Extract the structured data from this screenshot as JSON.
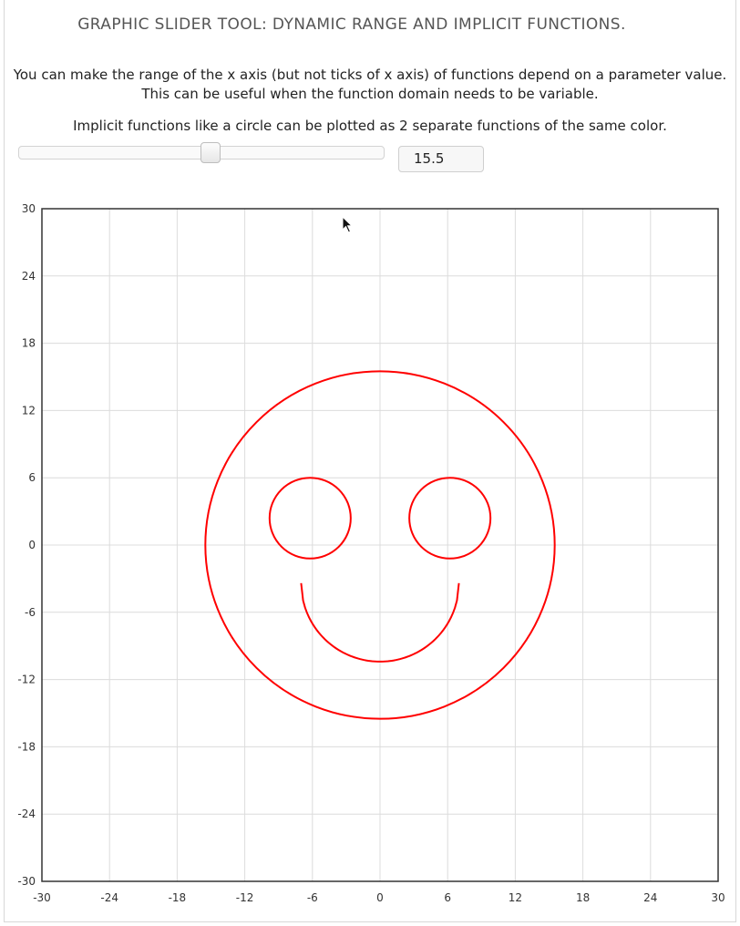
{
  "header": {
    "title": "GRAPHIC SLIDER TOOL: DYNAMIC RANGE AND IMPLICIT FUNCTIONS.",
    "description_line1": "You can make the range of the x axis (but not ticks of x axis) of functions depend on a parameter value.",
    "description_line2": "This can be useful when the function domain needs to be variable.",
    "description_line3": "Implicit functions like a circle can be plotted as 2 separate functions of the same color."
  },
  "slider": {
    "value": "15.5",
    "min": 0,
    "max": 30
  },
  "chart_data": {
    "type": "line",
    "xlim": [
      -30,
      30
    ],
    "ylim": [
      -30,
      30
    ],
    "xticks": [
      "-30",
      "-24",
      "-18",
      "-12",
      "-6",
      "0",
      "6",
      "12",
      "18",
      "24",
      "30"
    ],
    "yticks": [
      "30",
      "24",
      "18",
      "12",
      "6",
      "0",
      "-6",
      "-12",
      "-18",
      "-24",
      "-30"
    ],
    "grid": true,
    "color": "#ff0000",
    "curves": [
      {
        "kind": "circle",
        "cx": 0,
        "cy": 0,
        "r": 15.5
      },
      {
        "kind": "circle",
        "cx": -6.2,
        "cy": 2.4,
        "r": 3.6
      },
      {
        "kind": "circle",
        "cx": 6.2,
        "cy": 2.4,
        "r": 3.6
      },
      {
        "kind": "arc",
        "cx": 0,
        "cy": -3.4,
        "r": 7,
        "x_from": -7,
        "x_to": 7,
        "branch": "lower"
      }
    ]
  }
}
